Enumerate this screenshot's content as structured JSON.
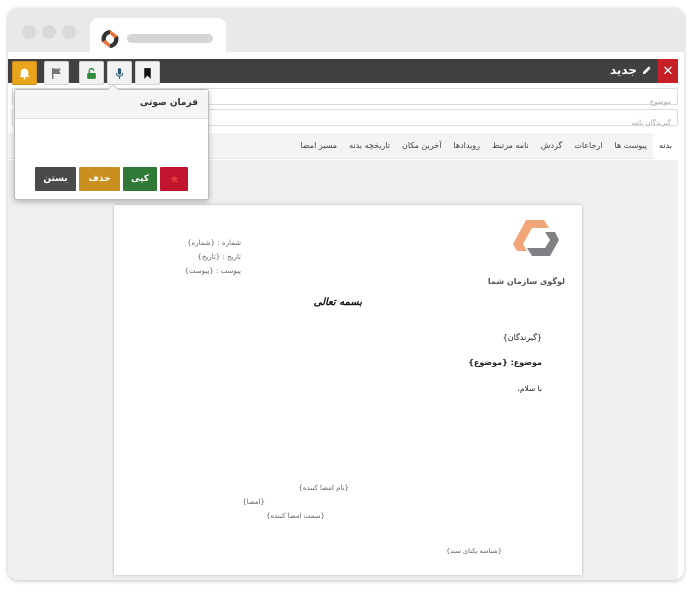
{
  "browser": {
    "tab_logo_icon": "brand-logo-icon"
  },
  "editor": {
    "title": "جدید",
    "close_icon": "close-icon",
    "title_icon": "pencil-icon",
    "toolbar": [
      {
        "name": "bookmark-button",
        "icon": "bookmark-icon"
      },
      {
        "name": "microphone-button",
        "icon": "microphone-icon"
      },
      {
        "name": "unlock-button",
        "icon": "unlock-icon"
      },
      {
        "name": "flag-button",
        "icon": "flag-icon"
      },
      {
        "name": "bell-button",
        "icon": "bell-icon"
      }
    ],
    "subject_placeholder": "موضوع",
    "recipients_placeholder": "گیرندگان نامه"
  },
  "tabs": [
    "بدنه",
    "پیوست ها",
    "ارجاعات",
    "گردش",
    "نامه مرتبط",
    "رویدادها",
    "آخرین مکان",
    "تاریخچه بدنه",
    "مسیر امضا"
  ],
  "voice_popup": {
    "title": "فرمان صوتی",
    "record_icon": "record-icon",
    "copy_label": "کپی",
    "delete_label": "حذف",
    "close_label": "بستن"
  },
  "letter": {
    "number_line": "شماره : {شماره}",
    "date_line": "تاریخ : {تاریخ}",
    "attachment_line": "پیوست : {پیوست}",
    "logo_text": "لوگوی سازمان شما",
    "basmala": "بسمه تعالی",
    "recipients": "{گیرندگان}",
    "subject_label": "موضوع:",
    "subject_value": "{موضوع}",
    "greeting": "با سلام،",
    "signer_name": "{نام امضا کننده}",
    "signature": "{امضا}",
    "signer_position": "{سمت امضا کننده}",
    "doc_id": "{شناسه یکتای سند}"
  },
  "colors": {
    "toolbar_bg": "#414141",
    "close_red": "#c62026",
    "bell_yellow": "#e8a41b",
    "record_red": "#c0142f",
    "copy_green": "#2f7a36",
    "delete_gold": "#c99020",
    "close_gray": "#4a4a4a",
    "logo_orange": "#f3a57a",
    "logo_gray": "#7f8184"
  }
}
